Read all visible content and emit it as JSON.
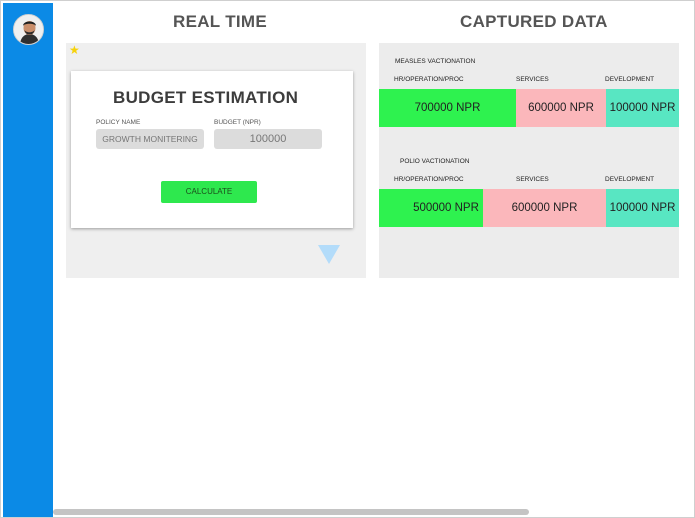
{
  "headings": {
    "real_time": "REAL TIME",
    "captured_data": "CAPTURED DATA"
  },
  "budget_form": {
    "title": "BUDGET ESTIMATION",
    "policy_label": "POLICY NAME",
    "policy_value": "GROWTH MONITERING",
    "budget_label": "BUDGET (NPR)",
    "budget_value": "100000",
    "calculate_label": "CALCULATE"
  },
  "captured": {
    "sections": [
      {
        "title": "MEASLES VACTIONATION",
        "columns": [
          "HR/OPERATION/PROC",
          "SERVICES",
          "DEVELOPMENT"
        ],
        "values": [
          "700000 NPR",
          "600000 NPR",
          "100000 NPR"
        ]
      },
      {
        "title": "POLIO VACTIONATION",
        "columns": [
          "HR/OPERATION/PROC",
          "SERVICES",
          "DEVELOPMENT"
        ],
        "values": [
          "500000 NPR",
          "600000 NPR",
          "100000 NPR"
        ]
      }
    ]
  },
  "colors": {
    "sidebar": "#0b8ae6",
    "hr": "#2ef24f",
    "services": "#fbb7bb",
    "development": "#58e6c2",
    "calculate": "#2ee84e"
  },
  "icons": {
    "star": "star-icon",
    "triangle": "triangle-down-icon",
    "avatar": "avatar"
  }
}
